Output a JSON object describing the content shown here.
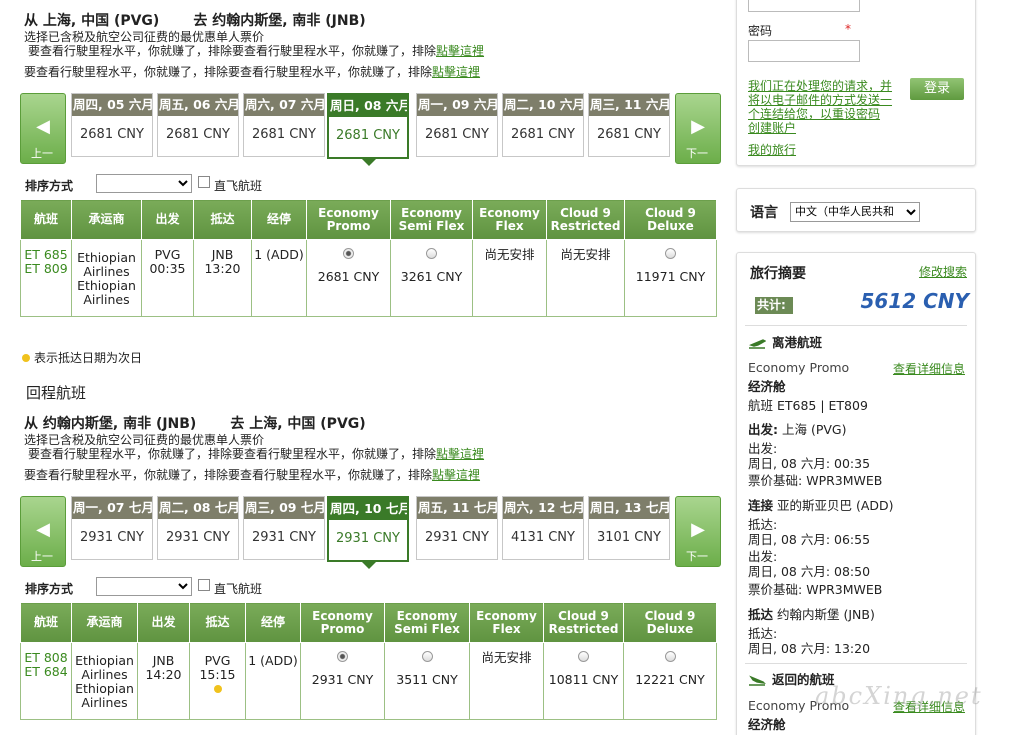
{
  "outbound": {
    "from": "从 上海, 中国 (PVG)",
    "to": "去 约翰内斯堡, 南非 (JNB)",
    "note1": "选择已含税及航空公司征费的最优惠单人票价",
    "note2": "要查看行駛里程水平，你就赚了，排除要查看行駛里程水平，你就赚了，排除",
    "note2_link": "點擊這裡",
    "note3": "要查看行駛里程水平，你就赚了，排除要查看行駛里程水平，你就赚了，排除",
    "note3_link": "點擊這裡",
    "prev": "上一",
    "next": "下一",
    "days": [
      {
        "label": "周四, 05 六月",
        "price": "2681 CNY"
      },
      {
        "label": "周五, 06 六月",
        "price": "2681 CNY"
      },
      {
        "label": "周六, 07 六月",
        "price": "2681 CNY"
      },
      {
        "label": "周日, 08 六月",
        "price": "2681 CNY"
      },
      {
        "label": "周一, 09 六月",
        "price": "2681 CNY"
      },
      {
        "label": "周二, 10 六月",
        "price": "2681 CNY"
      },
      {
        "label": "周三, 11 六月",
        "price": "2681 CNY"
      }
    ],
    "sort_label": "排序方式",
    "direct_label": "直飞航班",
    "headers": [
      "航班",
      "承运商",
      "出发",
      "抵达",
      "经停",
      "Economy Promo",
      "Economy Semi Flex",
      "Economy Flex",
      "Cloud 9 Restricted",
      "Cloud 9 Deluxe"
    ],
    "row": {
      "flight1": "ET 685",
      "flight2": "ET 809",
      "carrier1": "Ethiopian Airlines",
      "carrier2": "Ethiopian Airlines",
      "dep_code": "PVG",
      "dep_time": "00:35",
      "arr_code": "JNB",
      "arr_time": "13:20",
      "stops": "1 (ADD)",
      "p1": "2681 CNY",
      "p2": "3261 CNY",
      "p3": "尚无安排",
      "p4": "尚无安排",
      "p5": "11971 CNY"
    }
  },
  "legend": "表示抵达日期为次日",
  "return_title": "回程航班",
  "inbound": {
    "from": "从 约翰内斯堡, 南非 (JNB)",
    "to": "去 上海, 中国 (PVG)",
    "note1": "选择已含税及航空公司征费的最优惠单人票价",
    "note2": "要查看行駛里程水平，你就赚了，排除要查看行駛里程水平，你就赚了，排除",
    "note2_link": "點擊這裡",
    "note3": "要查看行駛里程水平，你就赚了，排除要查看行駛里程水平，你就赚了，排除",
    "note3_link": "點擊這裡",
    "prev": "上一",
    "next": "下一",
    "days": [
      {
        "label": "周一, 07 七月",
        "price": "2931 CNY"
      },
      {
        "label": "周二, 08 七月",
        "price": "2931 CNY"
      },
      {
        "label": "周三, 09 七月",
        "price": "2931 CNY"
      },
      {
        "label": "周四, 10 七月",
        "price": "2931 CNY"
      },
      {
        "label": "周五, 11 七月",
        "price": "2931 CNY"
      },
      {
        "label": "周六, 12 七月",
        "price": "4131 CNY"
      },
      {
        "label": "周日, 13 七月",
        "price": "3101 CNY"
      }
    ],
    "sort_label": "排序方式",
    "direct_label": "直飞航班",
    "headers": [
      "航班",
      "承运商",
      "出发",
      "抵达",
      "经停",
      "Economy Promo",
      "Economy Semi Flex",
      "Economy Flex",
      "Cloud 9 Restricted",
      "Cloud 9 Deluxe"
    ],
    "row": {
      "flight1": "ET 808",
      "flight2": "ET 684",
      "carrier1": "Ethiopian Airlines",
      "carrier2": "Ethiopian Airlines",
      "dep_code": "JNB",
      "dep_time": "14:20",
      "arr_code": "PVG",
      "arr_time": "15:15",
      "stops": "1 (ADD)",
      "p1": "2931 CNY",
      "p2": "3511 CNY",
      "p3": "尚无安排",
      "p4": "10811 CNY",
      "p5": "12221 CNY"
    }
  },
  "login": {
    "password_label": "密码",
    "required_mark": "*",
    "message": "我们正在处理您的请求，并将以电子邮件的方式发送一个连结给您，以重设密码",
    "create_account": "创建账户",
    "login_button": "登录",
    "my_trip": "我的旅行"
  },
  "language": {
    "label": "语言",
    "selected": "中文（中华人民共和"
  },
  "summary": {
    "title": "旅行摘要",
    "modify": "修改搜索",
    "total_label": "共计:",
    "total": "5612 CNY",
    "depart_title": "离港航班",
    "fare": "Economy Promo",
    "details": "查看详细信息",
    "cabin": "经济舱",
    "flights": "航班 ET685 | ET809",
    "origin_label": "出发:",
    "origin": "上海 (PVG)",
    "dep_label": "出发:",
    "dep_time": "周日, 08 六月: 00:35",
    "basis_label": "票价基础:",
    "basis": "WPR3MWEB",
    "connect_label": "连接",
    "connect": "亚的斯亚贝巴 (ADD)",
    "arr2_label": "抵达:",
    "arr2_time": "周日, 08 六月: 06:55",
    "dep2_label": "出发:",
    "dep2_time": "周日, 08 六月: 08:50",
    "basis2_label": "票价基础:",
    "basis2": "WPR3MWEB",
    "dest_label": "抵达",
    "dest": "约翰内斯堡 (JNB)",
    "arr_label": "抵达:",
    "arr_time": "周日, 08 六月: 13:20",
    "return_title": "返回的航班",
    "return_fare": "Economy Promo",
    "return_details": "查看详细信息",
    "return_cabin": "经济舱"
  },
  "watermark": "abcXing.net",
  "colors": {
    "accent": "#5f9340",
    "total": "#2a5fb0",
    "link": "#3a8a1f"
  }
}
